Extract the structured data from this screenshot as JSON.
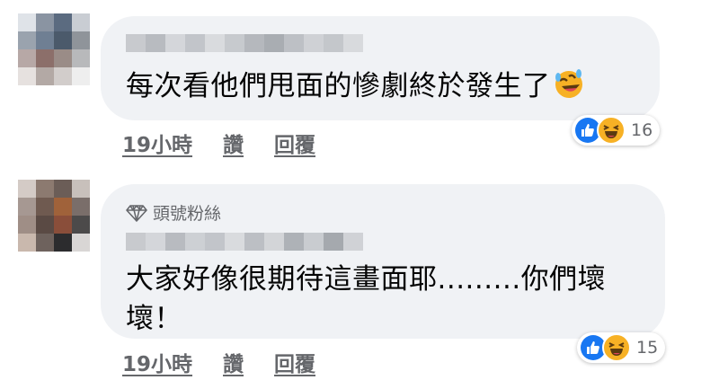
{
  "comments": [
    {
      "badge": "",
      "text_lines": [
        "每次看他們甩面的慘劇終於發生了"
      ],
      "trailing_emoji": "rofl-emoji",
      "actions": {
        "time": "19小時",
        "like": "讚",
        "reply": "回覆"
      },
      "reactions": {
        "icons": [
          "like-icon",
          "haha-icon"
        ],
        "count": "16"
      },
      "colors": {
        "like": "#1877f2",
        "haha": "#f7b125"
      }
    },
    {
      "badge": "頭號粉絲",
      "text_lines": [
        "大家好像很期待這畫面耶.........你們壞",
        "壞！"
      ],
      "trailing_emoji": "",
      "actions": {
        "time": "19小時",
        "like": "讚",
        "reply": "回覆"
      },
      "reactions": {
        "icons": [
          "like-icon",
          "haha-icon"
        ],
        "count": "15"
      },
      "colors": {
        "like": "#1877f2",
        "haha": "#f7b125"
      }
    }
  ]
}
